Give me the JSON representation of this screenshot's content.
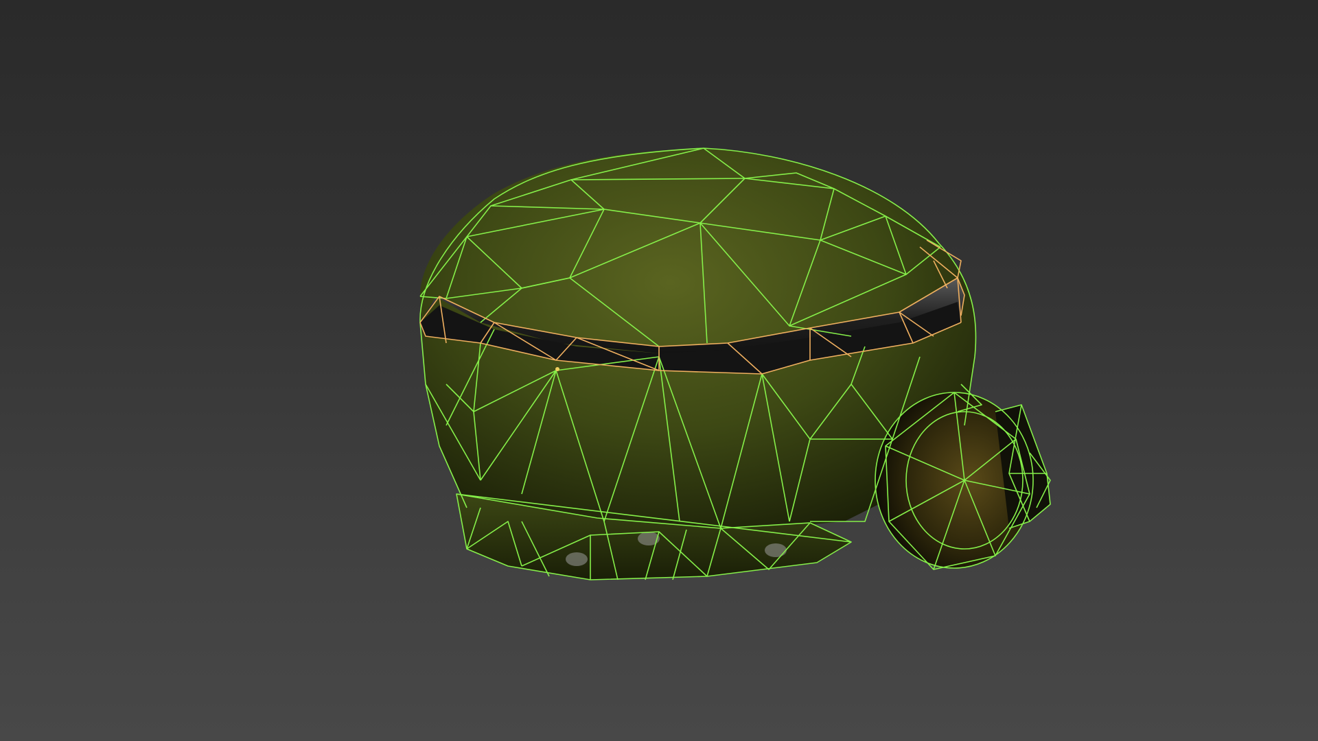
{
  "viewport": {
    "background_top": "#2a2a2a",
    "background_bottom": "#484848"
  },
  "model": {
    "subject": "helmet-wireframe-icon",
    "shell_color": "#3f4a14",
    "shell_shadow": "#1c2108",
    "band_color": "#262626",
    "wire_color": "#86f04a",
    "selected_wire_color": "#f0b060",
    "light_housing_color": "#2e2a10"
  }
}
